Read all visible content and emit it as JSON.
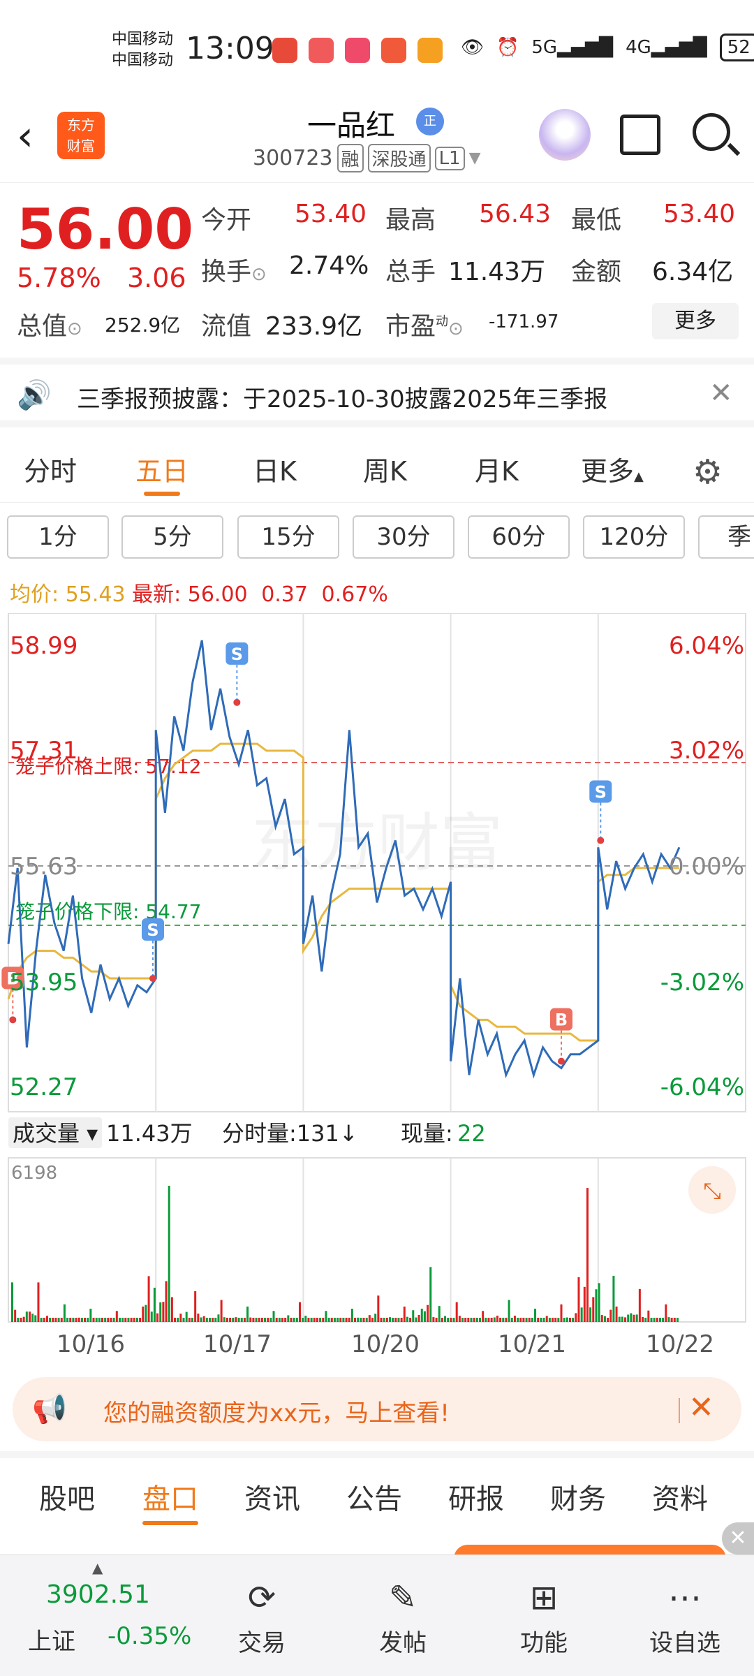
{
  "status": {
    "carrier1": "中国移动",
    "carrier2": "中国移动",
    "time": "13:09",
    "signal": "5G",
    "signal2": "4G",
    "battery": "52"
  },
  "header": {
    "back_icon": "back-arrow-icon",
    "logo_text1": "东方",
    "logo_text2": "财富",
    "stock_name": "一品红",
    "badge": "正",
    "code": "300723",
    "tag_rong": "融",
    "tag_sgt": "深股通",
    "tag_l1": "L1"
  },
  "quote": {
    "price": "56.00",
    "change_pct": "5.78%",
    "change": "3.06",
    "open_label": "今开",
    "open": "53.40",
    "high_label": "最高",
    "high": "56.43",
    "low_label": "最低",
    "low": "53.40",
    "turnover_label": "换手",
    "turnover": "2.74%",
    "volume_label": "总手",
    "volume": "11.43万",
    "amount_label": "金额",
    "amount": "6.34亿",
    "mktcap_label": "总值",
    "mktcap": "252.9亿",
    "float_label": "流值",
    "float": "233.9亿",
    "pe_label": "市盈",
    "pe_sup": "动",
    "pe": "-171.97",
    "more": "更多"
  },
  "notice": {
    "text": "三季报预披露：于2025-10-30披露2025年三季报"
  },
  "period_tabs": [
    "分时",
    "五日",
    "日K",
    "周K",
    "月K",
    "更多"
  ],
  "minute_buttons": [
    "1分",
    "5分",
    "15分",
    "30分",
    "60分",
    "120分",
    "季"
  ],
  "avg": {
    "avg_label": "均价:",
    "avg_value": "55.43",
    "latest_label": "最新:",
    "latest_value": "56.00",
    "latest_change": "0.37",
    "latest_pct": "0.67%"
  },
  "chart_data": {
    "type": "line",
    "price_axis_left": [
      "58.99",
      "57.31",
      "55.63",
      "53.95",
      "52.27"
    ],
    "price_axis_right": [
      "6.04%",
      "3.02%",
      "0.00%",
      "-3.02%",
      "-6.04%"
    ],
    "ylim": [
      52.27,
      58.99
    ],
    "upper_limit_label": "笼子价格上限:",
    "upper_limit_value": "57.12",
    "lower_limit_label": "笼子价格下限:",
    "lower_limit_value": "54.77",
    "watermark": "东方财富",
    "x_labels": [
      "10/16",
      "10/17",
      "10/20",
      "10/21",
      "10/22"
    ],
    "series": [
      {
        "values": [
          54.5,
          55.6,
          53.0,
          54.4,
          55.5,
          54.8,
          54.4,
          55.2,
          54.0,
          53.5,
          54.2,
          53.7,
          54.0,
          53.6,
          53.9,
          53.8,
          54.0,
          57.6,
          56.4,
          57.8,
          57.3,
          58.3,
          58.9,
          57.6,
          58.2,
          57.5,
          57.1,
          57.6,
          56.8,
          56.9,
          56.2,
          56.6,
          55.8,
          55.9,
          54.5,
          55.2,
          54.1,
          55.2,
          55.8,
          57.6,
          55.9,
          56.1,
          55.1,
          55.6,
          56.0,
          55.2,
          55.3,
          55.0,
          55.3,
          54.9,
          55.4,
          52.8,
          54.0,
          52.6,
          53.4,
          52.9,
          53.2,
          52.6,
          52.9,
          53.1,
          52.6,
          53.0,
          52.8,
          52.7,
          52.9,
          52.9,
          53.0,
          53.1,
          55.9,
          55.0,
          55.7,
          55.3,
          55.6,
          55.8,
          55.4,
          55.8,
          55.6,
          55.9
        ]
      },
      {
        "values": [
          53.7,
          54.1,
          54.3,
          54.4,
          54.4,
          54.4,
          54.3,
          54.3,
          54.2,
          54.1,
          54.1,
          54.0,
          54.0,
          54.0,
          54.0,
          54.0,
          54.0,
          56.6,
          56.9,
          57.1,
          57.2,
          57.3,
          57.3,
          57.3,
          57.4,
          57.4,
          57.4,
          57.4,
          57.4,
          57.3,
          57.3,
          57.3,
          57.3,
          57.2,
          54.4,
          54.6,
          54.9,
          55.1,
          55.2,
          55.3,
          55.3,
          55.3,
          55.3,
          55.3,
          55.3,
          55.3,
          55.3,
          55.3,
          55.3,
          55.3,
          55.3,
          53.9,
          53.6,
          53.5,
          53.4,
          53.4,
          53.3,
          53.3,
          53.3,
          53.2,
          53.2,
          53.2,
          53.2,
          53.2,
          53.2,
          53.1,
          53.1,
          53.1,
          55.4,
          55.5,
          55.5,
          55.5,
          55.6,
          55.6,
          55.6,
          55.6,
          55.6,
          55.6
        ]
      }
    ],
    "markers": [
      {
        "label": "B",
        "day": 0,
        "at": 0.03,
        "price": 53.4
      },
      {
        "label": "S",
        "day": 0,
        "at": 0.98,
        "price": 54.0
      },
      {
        "label": "S",
        "day": 1,
        "at": 0.55,
        "price": 58.0
      },
      {
        "label": "B",
        "day": 3,
        "at": 0.75,
        "price": 52.8
      },
      {
        "label": "S",
        "day": 4,
        "at": 0.03,
        "price": 56.0
      }
    ],
    "volume_label": "成交量",
    "volume_total": "11.43万",
    "fenshi_label": "分时量:",
    "fenshi_value": "131",
    "current_label": "现量:",
    "current_value": "22",
    "volume_max": "6198",
    "volume_peaks": [
      1800,
      800,
      600,
      500,
      700,
      6198,
      1400,
      1000,
      700,
      500,
      900,
      500,
      600,
      1200,
      700,
      2500,
      900,
      500,
      1000,
      600,
      800,
      6100,
      2100,
      1500,
      800
    ]
  },
  "banner": {
    "text": "您的融资额度为xx元，马上查看!"
  },
  "bottom_tabs": [
    "股吧",
    "盘口",
    "资讯",
    "公告",
    "研报",
    "财务",
    "资料"
  ],
  "bottom_bar": {
    "index_value": "3902.51",
    "index_name": "上证",
    "index_change": "-0.35%",
    "nav": [
      {
        "label": "交易",
        "icon": "yen-refresh-icon"
      },
      {
        "label": "发帖",
        "icon": "edit-icon"
      },
      {
        "label": "功能",
        "icon": "grid-icon"
      },
      {
        "label": "设自选",
        "icon": "more-dots-icon"
      }
    ]
  },
  "colors": {
    "up": "#e02020",
    "down": "#0a9a3a",
    "accent": "#f07a1a",
    "price_line": "#2f6bb8",
    "avg_line": "#e8b840"
  }
}
